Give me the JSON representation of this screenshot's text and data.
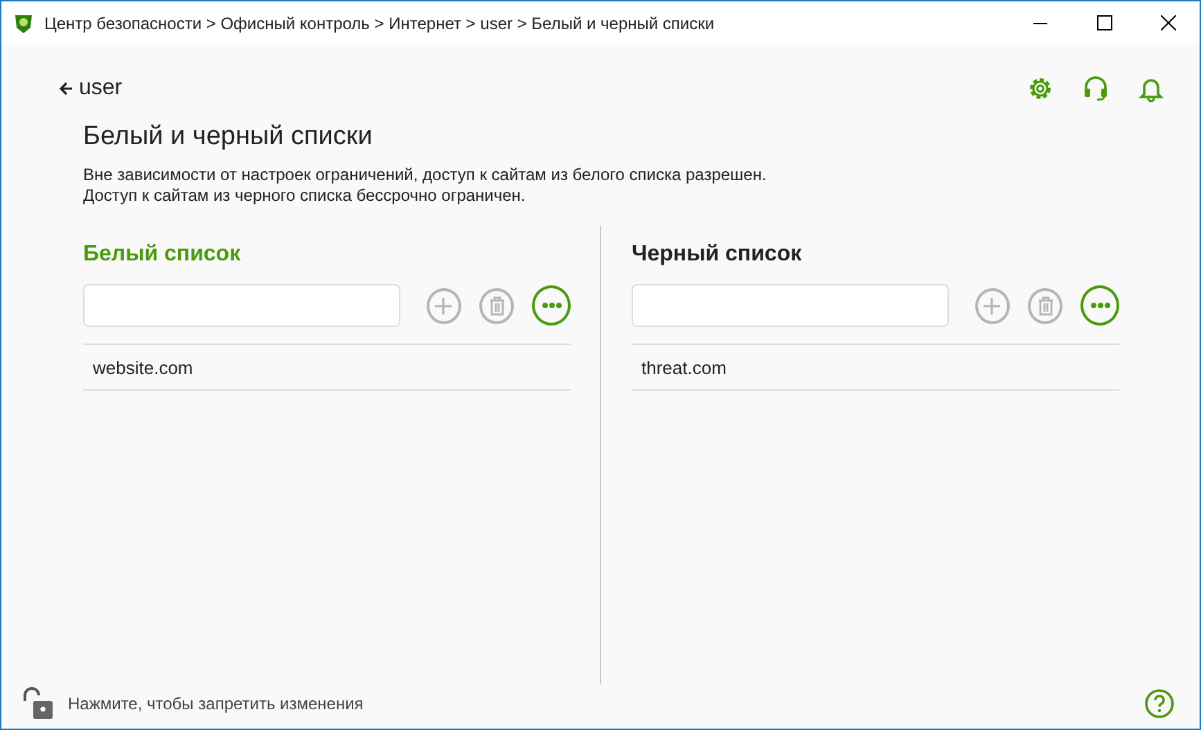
{
  "window": {
    "title": "Центр безопасности > Офисный контроль > Интернет > user > Белый и черный списки"
  },
  "back": {
    "label": "user"
  },
  "page": {
    "title": "Белый и черный списки",
    "description": [
      "Вне зависимости от настроек ограничений, доступ к сайтам из белого списка разрешен.",
      "Доступ к сайтам из черного списка бессрочно ограничен."
    ]
  },
  "lists": [
    {
      "title": "Белый список",
      "selected": true,
      "items": [
        "website.com"
      ]
    },
    {
      "title": "Черный список",
      "selected": false,
      "items": [
        "threat.com"
      ]
    }
  ],
  "status_bar": {
    "text": "Нажмите, чтобы запретить изменения"
  }
}
